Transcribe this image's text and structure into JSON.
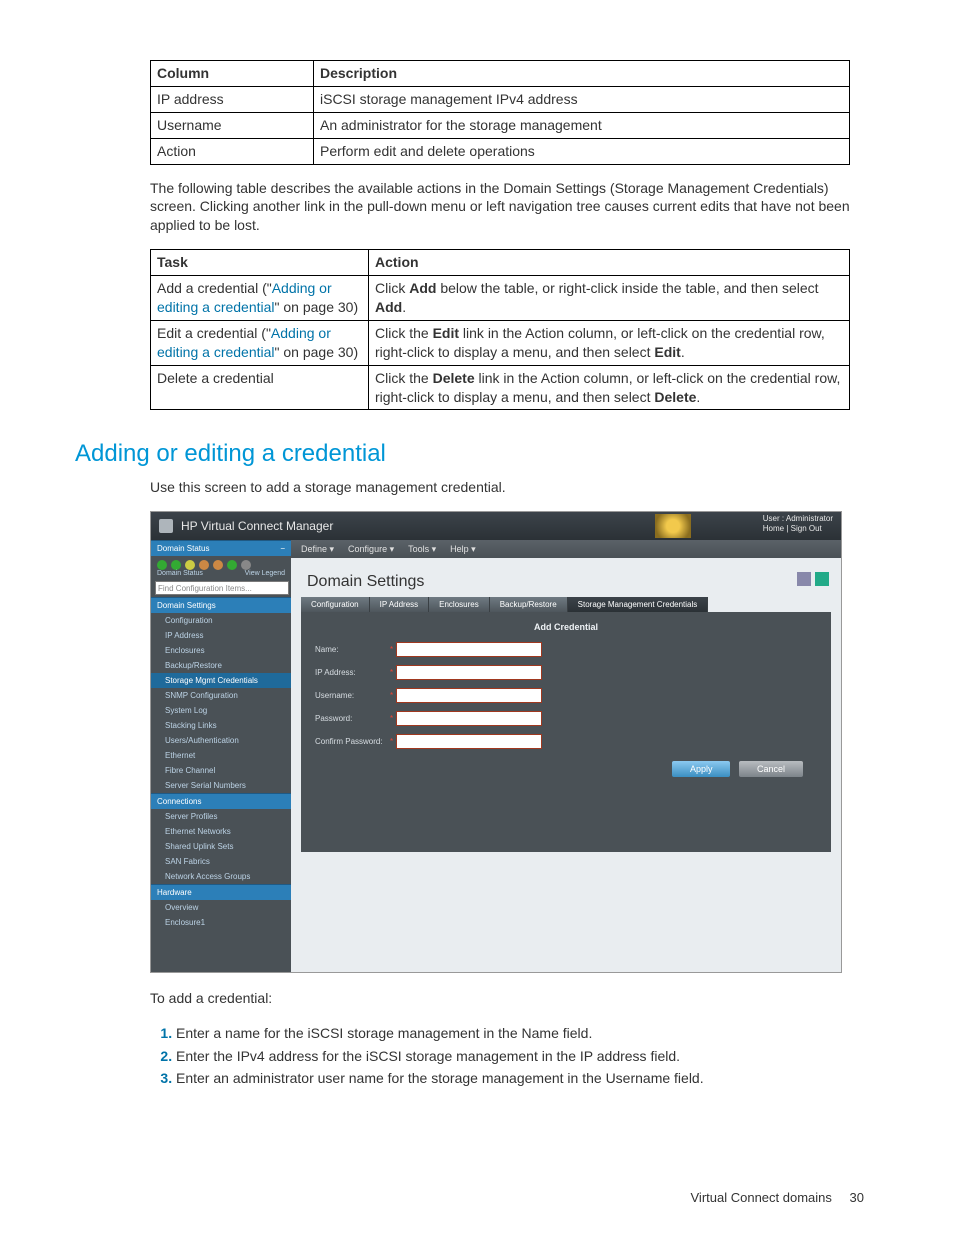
{
  "table1": {
    "headers": [
      "Column",
      "Description"
    ],
    "rows": [
      [
        "IP address",
        "iSCSI storage management IPv4 address"
      ],
      [
        "Username",
        "An administrator for the storage management"
      ],
      [
        "Action",
        "Perform edit and delete operations"
      ]
    ]
  },
  "para1": "The following table describes the available actions in the Domain Settings (Storage Management Credentials) screen. Clicking another link in the pull-down menu or left navigation tree causes current edits that have not been applied to be lost.",
  "table2": {
    "headers": [
      "Task",
      "Action"
    ],
    "rows": [
      {
        "task_prefix": "Add a credential (\"",
        "task_link": "Adding or editing a credential",
        "task_suffix": "\" on page 30)",
        "action_pre": "Click ",
        "action_b1": "Add",
        "action_mid": " below the table, or right-click inside the table, and then select ",
        "action_b2": "Add",
        "action_post": "."
      },
      {
        "task_prefix": "Edit a credential (\"",
        "task_link": "Adding or editing a credential",
        "task_suffix": "\" on page 30)",
        "action_pre": "Click the ",
        "action_b1": "Edit",
        "action_mid": " link in the Action column, or left-click on the credential row, right-click to display a menu, and then select ",
        "action_b2": "Edit",
        "action_post": "."
      },
      {
        "task_plain": "Delete a credential",
        "action_pre": "Click the ",
        "action_b1": "Delete",
        "action_mid": " link in the Action column, or left-click on the credential row, right-click to display a menu, and then select ",
        "action_b2": "Delete",
        "action_post": "."
      }
    ]
  },
  "section_title": "Adding or editing a credential",
  "intro_line": "Use this screen to add a storage management credential.",
  "vcm": {
    "product": "HP Virtual Connect Manager",
    "user_label": "User : Administrator",
    "home": "Home",
    "signout": "Sign Out",
    "menus": [
      "Define ▾",
      "Configure ▾",
      "Tools ▾",
      "Help ▾"
    ],
    "sidebar": {
      "status_header": "Domain Status",
      "legend_l": "Domain Status",
      "view_legend": "View Legend",
      "search_ph": "Find Configuration Items...",
      "sections": [
        {
          "title": "Domain Settings",
          "items": [
            "Configuration",
            "IP Address",
            "Enclosures",
            "Backup/Restore",
            "Storage Mgmt Credentials",
            "SNMP Configuration",
            "System Log",
            "Stacking Links"
          ],
          "active": 4
        },
        {
          "title_plain": "Users/Authentication"
        },
        {
          "title_plain": "Ethernet"
        },
        {
          "title_plain": "Fibre Channel"
        },
        {
          "title_plain": "Server Serial Numbers"
        },
        {
          "title": "Connections",
          "items": [
            "Server Profiles",
            "Ethernet Networks",
            "Shared Uplink Sets",
            "SAN Fabrics",
            "Network Access Groups"
          ]
        },
        {
          "title": "Hardware",
          "items": [
            "Overview",
            "Enclosure1"
          ]
        }
      ]
    },
    "main": {
      "title": "Domain Settings",
      "tabs": [
        "Configuration",
        "IP Address",
        "Enclosures",
        "Backup/Restore",
        "Storage Management Credentials"
      ],
      "active_tab": 4,
      "panel_title": "Add Credential",
      "fields": [
        "Name:",
        "IP Address:",
        "Username:",
        "Password:",
        "Confirm Password:"
      ],
      "btn_apply": "Apply",
      "btn_cancel": "Cancel"
    }
  },
  "add_intro": "To add a credential:",
  "steps": [
    "Enter a name for the iSCSI storage management in the Name field.",
    "Enter the IPv4 address for the iSCSI storage management in the IP address field.",
    "Enter an administrator user name for the storage management in the Username field."
  ],
  "footer": {
    "section": "Virtual Connect domains",
    "page": "30"
  }
}
